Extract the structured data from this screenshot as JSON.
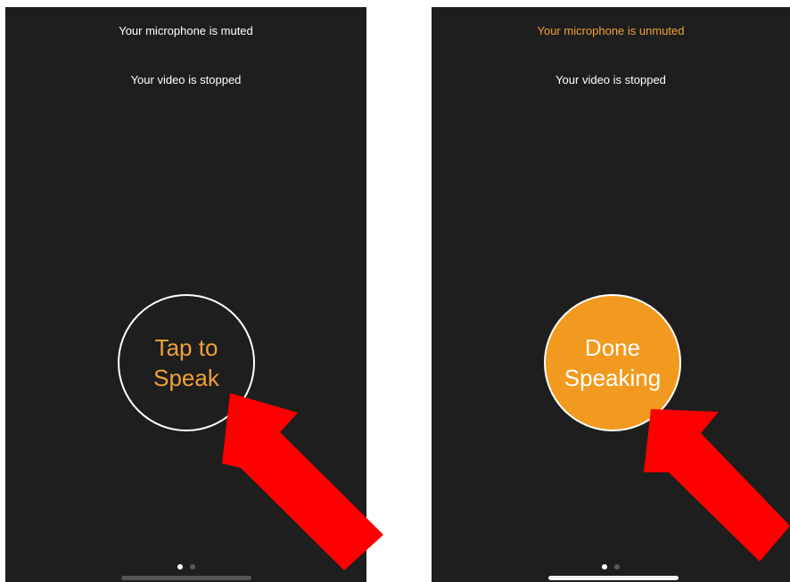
{
  "screens": [
    {
      "mic_status": "Your microphone is muted",
      "video_status": "Your video is stopped",
      "button_line1": "Tap to",
      "button_line2": "Speak"
    },
    {
      "mic_status": "Your microphone is unmuted",
      "video_status": "Your video is stopped",
      "button_line1": "Done",
      "button_line2": "Speaking"
    }
  ],
  "colors": {
    "accent": "#f0a03a",
    "button_fill": "#f29a1f",
    "background": "#1e1e1e",
    "arrow": "#ff0000"
  }
}
